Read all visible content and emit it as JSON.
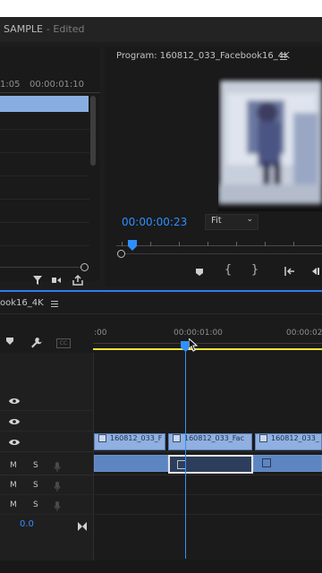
{
  "window": {
    "title": "SAMPLE",
    "status": "- Edited"
  },
  "source_panel": {
    "timecodes": [
      "1:05",
      "00:00:01:10"
    ]
  },
  "program_monitor": {
    "title": "Program: 160812_033_Facebook16_4K",
    "timecode": "00:00:00:23",
    "fit": "Fit",
    "menu_icon": "hamburger-icon"
  },
  "timeline": {
    "sequence_name": "ook16_4K",
    "ruler": [
      ":00",
      "00:00:01:00",
      "00:00:02"
    ],
    "audio_level": "0.0",
    "video_clips": [
      "160812_033_F",
      "160812_033_Fac",
      "160812_033_"
    ],
    "track_buttons": {
      "mute": "M",
      "solo": "S"
    }
  },
  "colors": {
    "accent": "#2f8fff",
    "clip_video": "#8fb0e0",
    "clip_audio": "#5d85c2",
    "work_area": "#e8e33a"
  }
}
